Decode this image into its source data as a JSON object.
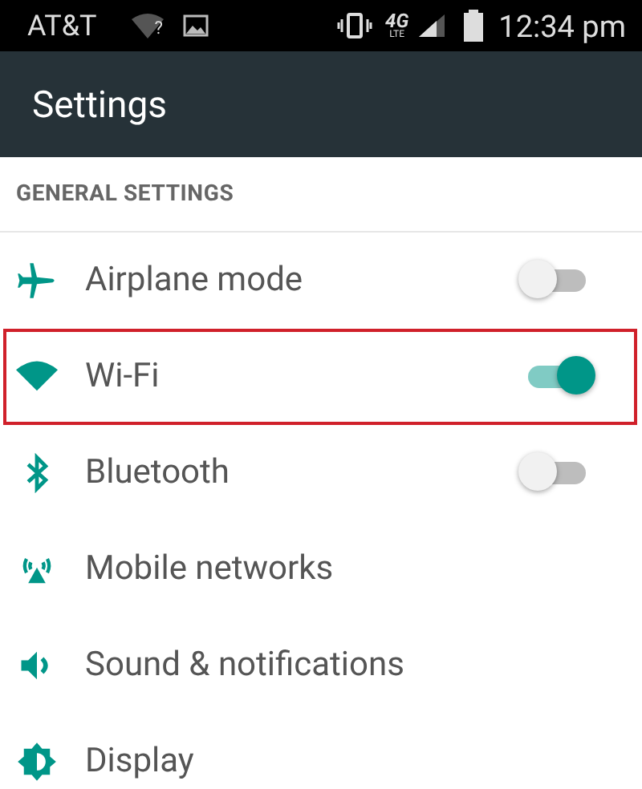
{
  "status_bar": {
    "carrier": "AT&T",
    "wifi_badge": "?",
    "network_type": "4G",
    "network_subtype": "LTE",
    "time": "12:34 pm"
  },
  "app_bar": {
    "title": "Settings"
  },
  "section": {
    "title": "GENERAL SETTINGS"
  },
  "items": [
    {
      "kind": "toggle",
      "label": "Airplane mode",
      "on": false,
      "highlighted": false
    },
    {
      "kind": "toggle",
      "label": "Wi-Fi",
      "on": true,
      "highlighted": true
    },
    {
      "kind": "toggle",
      "label": "Bluetooth",
      "on": false,
      "highlighted": false
    },
    {
      "kind": "plain",
      "label": "Mobile networks",
      "highlighted": false
    },
    {
      "kind": "plain",
      "label": "Sound & notifications",
      "highlighted": false
    },
    {
      "kind": "plain",
      "label": "Display",
      "highlighted": false
    }
  ]
}
